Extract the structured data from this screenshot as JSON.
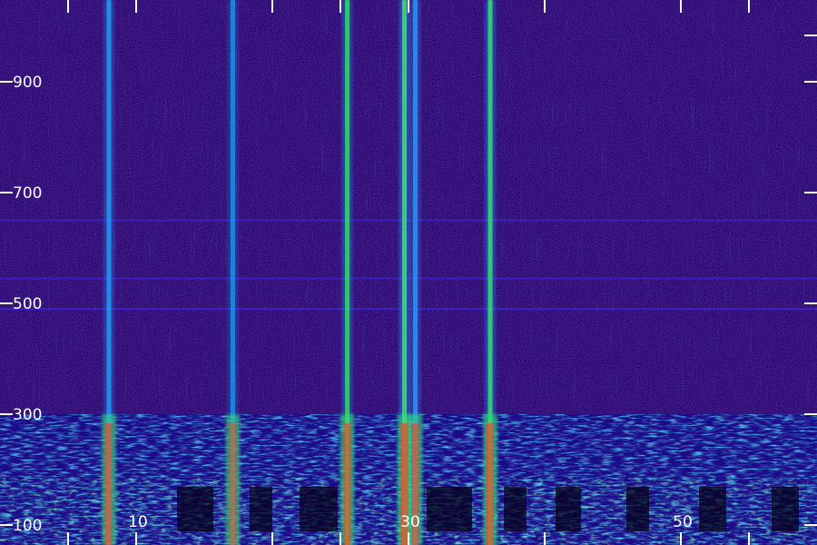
{
  "chart_data": {
    "type": "heatmap",
    "title": "",
    "xlabel": "",
    "ylabel": "",
    "xlim": [
      0,
      60
    ],
    "ylim": [
      100,
      1000
    ],
    "x_tick_labels": [
      {
        "value": 10,
        "label": "10"
      },
      {
        "value": 30,
        "label": "30"
      },
      {
        "value": 50,
        "label": "50"
      }
    ],
    "x_tick_marks": [
      5,
      10,
      20,
      25,
      30,
      40,
      50,
      55
    ],
    "y_tick_labels": [
      {
        "value": 100,
        "label": "100"
      },
      {
        "value": 300,
        "label": "300"
      },
      {
        "value": 500,
        "label": "500"
      },
      {
        "value": 700,
        "label": "700"
      },
      {
        "value": 900,
        "label": "900"
      }
    ],
    "vertical_lines": [
      {
        "x": 8.0,
        "intensity": 0.55
      },
      {
        "x": 17.1,
        "intensity": 0.35
      },
      {
        "x": 25.5,
        "intensity": 0.62
      },
      {
        "x": 29.7,
        "intensity": 0.85
      },
      {
        "x": 30.5,
        "intensity": 0.55
      },
      {
        "x": 36.0,
        "intensity": 0.7
      }
    ],
    "horizontal_lines": [
      {
        "y": 490,
        "intensity": 0.3
      },
      {
        "y": 545,
        "intensity": 0.22
      },
      {
        "y": 650,
        "intensity": 0.22
      }
    ],
    "low_band_top": 300,
    "colors": {
      "background": "#2a0a6e",
      "low": "#1a0a8a",
      "mid": "#1fa0ff",
      "high": "#37e06a",
      "peak": "#ff3b1f",
      "tick": "#ffffff"
    }
  }
}
